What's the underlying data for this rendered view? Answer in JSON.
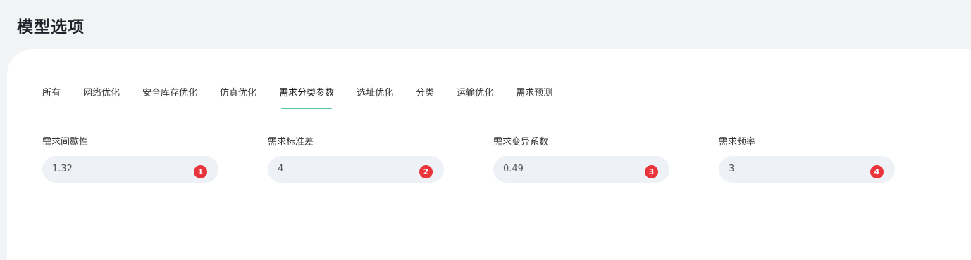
{
  "page": {
    "title": "模型选项"
  },
  "tabs": [
    {
      "label": "所有"
    },
    {
      "label": "网络优化"
    },
    {
      "label": "安全库存优化"
    },
    {
      "label": "仿真优化"
    },
    {
      "label": "需求分类参数",
      "active": true
    },
    {
      "label": "选址优化"
    },
    {
      "label": "分类"
    },
    {
      "label": "运输优化"
    },
    {
      "label": "需求预测"
    }
  ],
  "fields": [
    {
      "label": "需求间歇性",
      "value": "1.32",
      "badge": "1"
    },
    {
      "label": "需求标准差",
      "value": "4",
      "badge": "2"
    },
    {
      "label": "需求变异系数",
      "value": "0.49",
      "badge": "3"
    },
    {
      "label": "需求频率",
      "value": "3",
      "badge": "4"
    }
  ],
  "colors": {
    "active_tab_underline": "#4fc79a",
    "badge": "#e8343a",
    "input_background": "#eef1f5"
  }
}
